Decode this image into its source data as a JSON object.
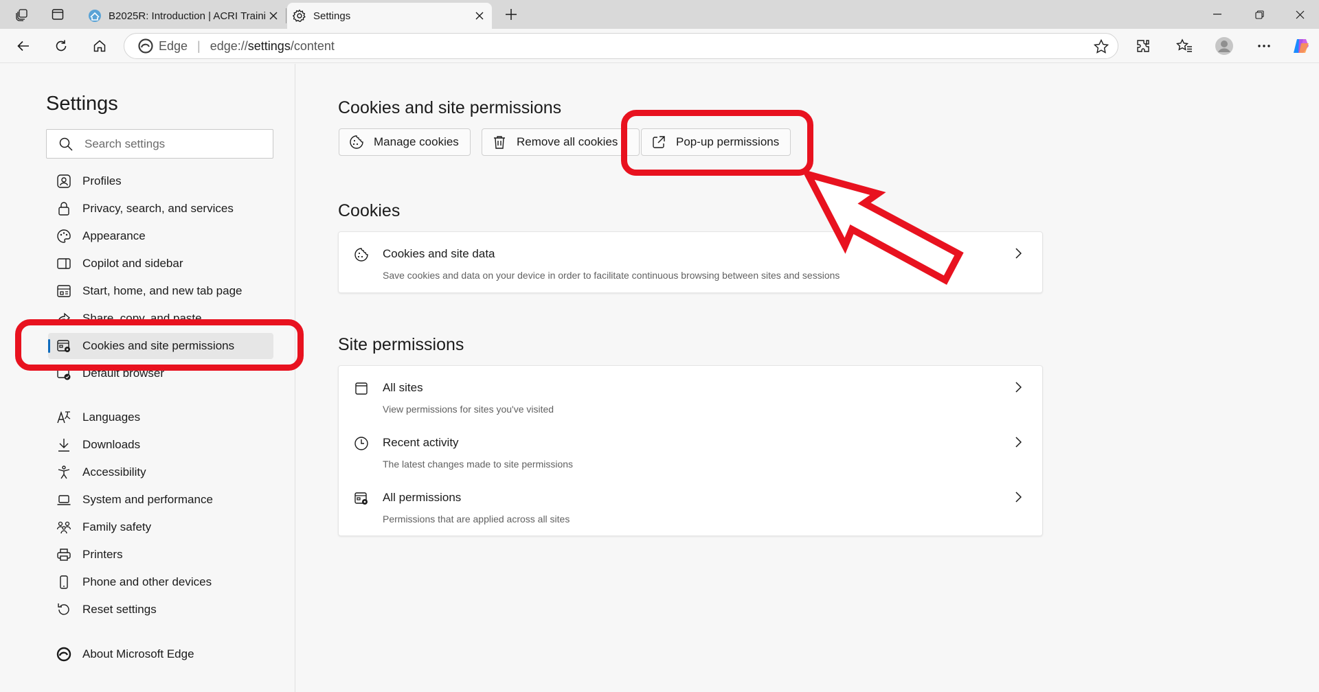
{
  "browser": {
    "tabs": [
      {
        "title": "B2025R: Introduction | ACRI Traini",
        "active": false
      },
      {
        "title": "Settings",
        "active": true
      }
    ],
    "address": {
      "brand": "Edge",
      "url_prefix": "edge://",
      "url_main": "settings",
      "url_suffix": "/content"
    }
  },
  "sidebar": {
    "title": "Settings",
    "search_placeholder": "Search settings",
    "items": [
      {
        "label": "Profiles",
        "icon": "profile-icon"
      },
      {
        "label": "Privacy, search, and services",
        "icon": "lock-icon"
      },
      {
        "label": "Appearance",
        "icon": "palette-icon"
      },
      {
        "label": "Copilot and sidebar",
        "icon": "sidebar-icon"
      },
      {
        "label": "Start, home, and new tab page",
        "icon": "home-page-icon"
      },
      {
        "label": "Share, copy, and paste",
        "icon": "share-icon"
      },
      {
        "label": "Cookies and site permissions",
        "icon": "cookie-permissions-icon",
        "active": true
      },
      {
        "label": "Default browser",
        "icon": "default-browser-icon"
      },
      {
        "label": "Languages",
        "icon": "languages-icon"
      },
      {
        "label": "Downloads",
        "icon": "download-icon"
      },
      {
        "label": "Accessibility",
        "icon": "accessibility-icon"
      },
      {
        "label": "System and performance",
        "icon": "laptop-icon"
      },
      {
        "label": "Family safety",
        "icon": "family-icon"
      },
      {
        "label": "Printers",
        "icon": "printer-icon"
      },
      {
        "label": "Phone and other devices",
        "icon": "phone-icon"
      },
      {
        "label": "Reset settings",
        "icon": "reset-icon"
      },
      {
        "label": "About Microsoft Edge",
        "icon": "edge-logo-icon"
      }
    ]
  },
  "main": {
    "section_title": "Cookies and site permissions",
    "buttons": [
      {
        "label": "Manage cookies",
        "icon": "cookie-icon"
      },
      {
        "label": "Remove all cookies",
        "icon": "trash-icon"
      },
      {
        "label": "Pop-up permissions",
        "icon": "open-external-icon"
      }
    ],
    "cookies": {
      "heading": "Cookies",
      "rows": [
        {
          "title": "Cookies and site data",
          "desc": "Save cookies and data on your device in order to facilitate continuous browsing between sites and sessions",
          "icon": "cookie-icon"
        }
      ]
    },
    "site_permissions": {
      "heading": "Site permissions",
      "rows": [
        {
          "title": "All sites",
          "desc": "View permissions for sites you've visited",
          "icon": "page-icon"
        },
        {
          "title": "Recent activity",
          "desc": "The latest changes made to site permissions",
          "icon": "clock-icon"
        },
        {
          "title": "All permissions",
          "desc": "Permissions that are applied across all sites",
          "icon": "permissions-icon"
        }
      ]
    }
  },
  "annotations": {
    "color": "#e8121f"
  },
  "colors": {
    "accent": "#0f6cbd",
    "background": "#f7f7f7"
  }
}
